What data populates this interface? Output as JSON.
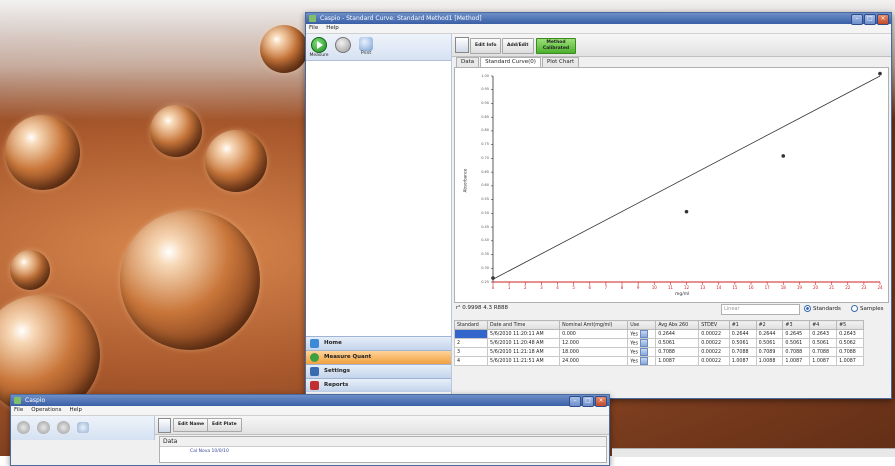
{
  "main_window": {
    "title": "Caspio - Standard Curve: Standard Method1 [Method]",
    "menu": [
      "File",
      "Help"
    ],
    "toolbar": [
      {
        "label": "Measure",
        "icon": "play-icon"
      },
      {
        "label": "",
        "icon": "disc-icon"
      },
      {
        "label": "Print",
        "icon": "print-icon"
      }
    ],
    "ribbon": [
      {
        "label": "Edit Info"
      },
      {
        "label": "Add/Edit"
      },
      {
        "label": "Method Calibrated",
        "accent": "#4cb02c"
      }
    ],
    "tabs": [
      "Data",
      "Standard Curve(0)",
      "Plot Chart"
    ],
    "active_tab": 1,
    "nav": [
      {
        "label": "Home",
        "icon": "home-icon",
        "color": "#3a8ad8"
      },
      {
        "label": "Measure Quant",
        "icon": "measure-icon",
        "color": "#3aa040",
        "active": true
      },
      {
        "label": "Settings",
        "icon": "settings-icon",
        "color": "#3a6ab0"
      },
      {
        "label": "Reports",
        "icon": "reports-icon",
        "color": "#c03030"
      }
    ],
    "status_text": "r² 0.9998 4.3 R888",
    "dropdown_placeholder": "Linear",
    "radio": [
      {
        "label": "Standards",
        "selected": true
      },
      {
        "label": "Samples",
        "selected": false
      }
    ],
    "table": {
      "columns": [
        "Standard",
        "Date and Time",
        "Nominal Amt(mg/ml)",
        "Use",
        "Avg Abs 260",
        "STDEV",
        "#1",
        "#2",
        "#3",
        "#4",
        "#5"
      ],
      "rows": [
        [
          "",
          "5/6/2010 11:20:11 AM",
          "0.000",
          "Yes",
          "0.2644",
          "0.00022",
          "0.2644",
          "0.2644",
          "0.2645",
          "0.2643",
          "0.2643"
        ],
        [
          "2",
          "5/6/2010 11:20:48 AM",
          "12.000",
          "Yes",
          "0.5061",
          "0.00022",
          "0.5061",
          "0.5061",
          "0.5061",
          "0.5061",
          "0.5062"
        ],
        [
          "3",
          "5/6/2010 11:21:18 AM",
          "18.000",
          "Yes",
          "0.7088",
          "0.00022",
          "0.7088",
          "0.7089",
          "0.7088",
          "0.7088",
          "0.7088"
        ],
        [
          "4",
          "5/6/2010 11:21:51 AM",
          "24.000",
          "Yes",
          "1.0087",
          "0.00022",
          "1.0087",
          "1.0088",
          "1.0087",
          "1.0087",
          "1.0087"
        ]
      ]
    }
  },
  "chart_data": {
    "type": "scatter",
    "title": "",
    "xlabel": "mg/ml",
    "ylabel": "Absorbance",
    "x_ticks": [
      "0",
      "1",
      "2",
      "3",
      "4",
      "5",
      "6",
      "7",
      "8",
      "9",
      "10",
      "11",
      "12",
      "13",
      "14",
      "15",
      "16",
      "17",
      "18",
      "19",
      "20",
      "21",
      "22",
      "23",
      "24"
    ],
    "y_ticks": [
      "0.25",
      "0.30",
      "0.35",
      "0.40",
      "0.45",
      "0.50",
      "0.55",
      "0.60",
      "0.65",
      "0.70",
      "0.75",
      "0.80",
      "0.85",
      "0.90",
      "0.95",
      "1.00"
    ],
    "xlim": [
      0,
      24
    ],
    "ylim": [
      0.25,
      1.0
    ],
    "series": [
      {
        "x": [
          0,
          12,
          18,
          24
        ],
        "y": [
          0.2644,
          0.5061,
          0.7088,
          1.0087
        ],
        "color": "#333333"
      }
    ],
    "fit_line": {
      "x": [
        0,
        24
      ],
      "y": [
        0.26,
        1.0
      ],
      "color": "#333333"
    },
    "grid": false
  },
  "second_window": {
    "title": "Caspio",
    "menu": [
      "File",
      "Operations",
      "Help"
    ],
    "ribbon": [
      {
        "label": "Edit Name"
      },
      {
        "label": "Edit Plate"
      }
    ],
    "tab": "Data",
    "tree_item": "Cal Nova 10/0/10"
  }
}
